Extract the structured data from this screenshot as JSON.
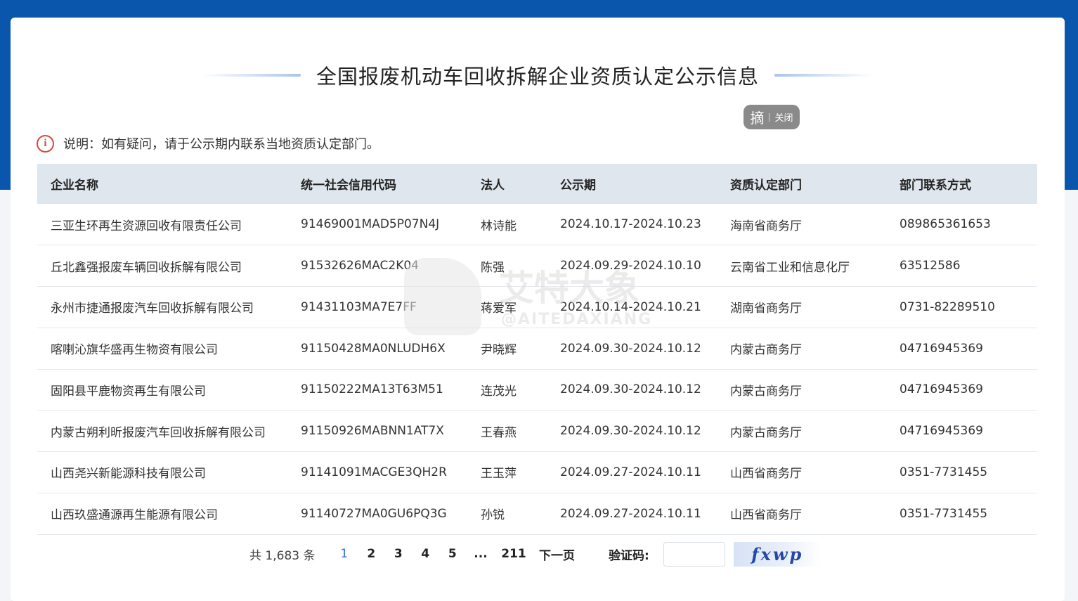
{
  "page": {
    "title": "全国报废机动车回收拆解企业资质认定公示信息",
    "notice": "说明：如有疑问，请于公示期内联系当地资质认定部门。",
    "notice_icon": "info-circle-icon",
    "accent_color": "#0a56ad"
  },
  "float_button": {
    "big": "摘",
    "small": "关闭"
  },
  "watermark": {
    "brand": "艾特大象",
    "handle": "@AITEDAXIANG"
  },
  "table": {
    "columns": [
      "企业名称",
      "统一社会信用代码",
      "法人",
      "公示期",
      "资质认定部门",
      "部门联系方式"
    ],
    "rows": [
      [
        "三亚生环再生资源回收有限责任公司",
        "91469001MAD5P07N4J",
        "林诗能",
        "2024.10.17-2024.10.23",
        "海南省商务厅",
        "089865361653"
      ],
      [
        "丘北鑫强报废车辆回收拆解有限公司",
        "91532626MAC2K04",
        "陈强",
        "2024.09.29-2024.10.10",
        "云南省工业和信息化厅",
        "63512586"
      ],
      [
        "永州市捷通报废汽车回收拆解有限公司",
        "91431103MA7E7FF",
        "蒋爱军",
        "2024.10.14-2024.10.21",
        "湖南省商务厅",
        "0731-82289510"
      ],
      [
        "喀喇沁旗华盛再生物资有限公司",
        "91150428MA0NLUDH6X",
        "尹晓辉",
        "2024.09.30-2024.10.12",
        "内蒙古商务厅",
        "04716945369"
      ],
      [
        "固阳县平鹿物资再生有限公司",
        "91150222MA13T63M51",
        "连茂光",
        "2024.09.30-2024.10.12",
        "内蒙古商务厅",
        "04716945369"
      ],
      [
        "内蒙古朔利昕报废汽车回收拆解有限公司",
        "91150926MABNN1AT7X",
        "王春燕",
        "2024.09.30-2024.10.12",
        "内蒙古商务厅",
        "04716945369"
      ],
      [
        "山西尧兴新能源科技有限公司",
        "91141091MACGE3QH2R",
        "王玉萍",
        "2024.09.27-2024.10.11",
        "山西省商务厅",
        "0351-7731455"
      ],
      [
        "山西玖盛通源再生能源有限公司",
        "91140727MA0GU6PQ3G",
        "孙锐",
        "2024.09.27-2024.10.11",
        "山西省商务厅",
        "0351-7731455"
      ]
    ]
  },
  "pagination": {
    "total": "共 1,683 条",
    "pages": [
      "1",
      "2",
      "3",
      "4",
      "5"
    ],
    "current": "1",
    "ellipsis": "...",
    "last": "211",
    "next": "下一页",
    "captcha_label": "验证码:",
    "captcha_input_value": "",
    "captcha_text": "fxwp"
  }
}
